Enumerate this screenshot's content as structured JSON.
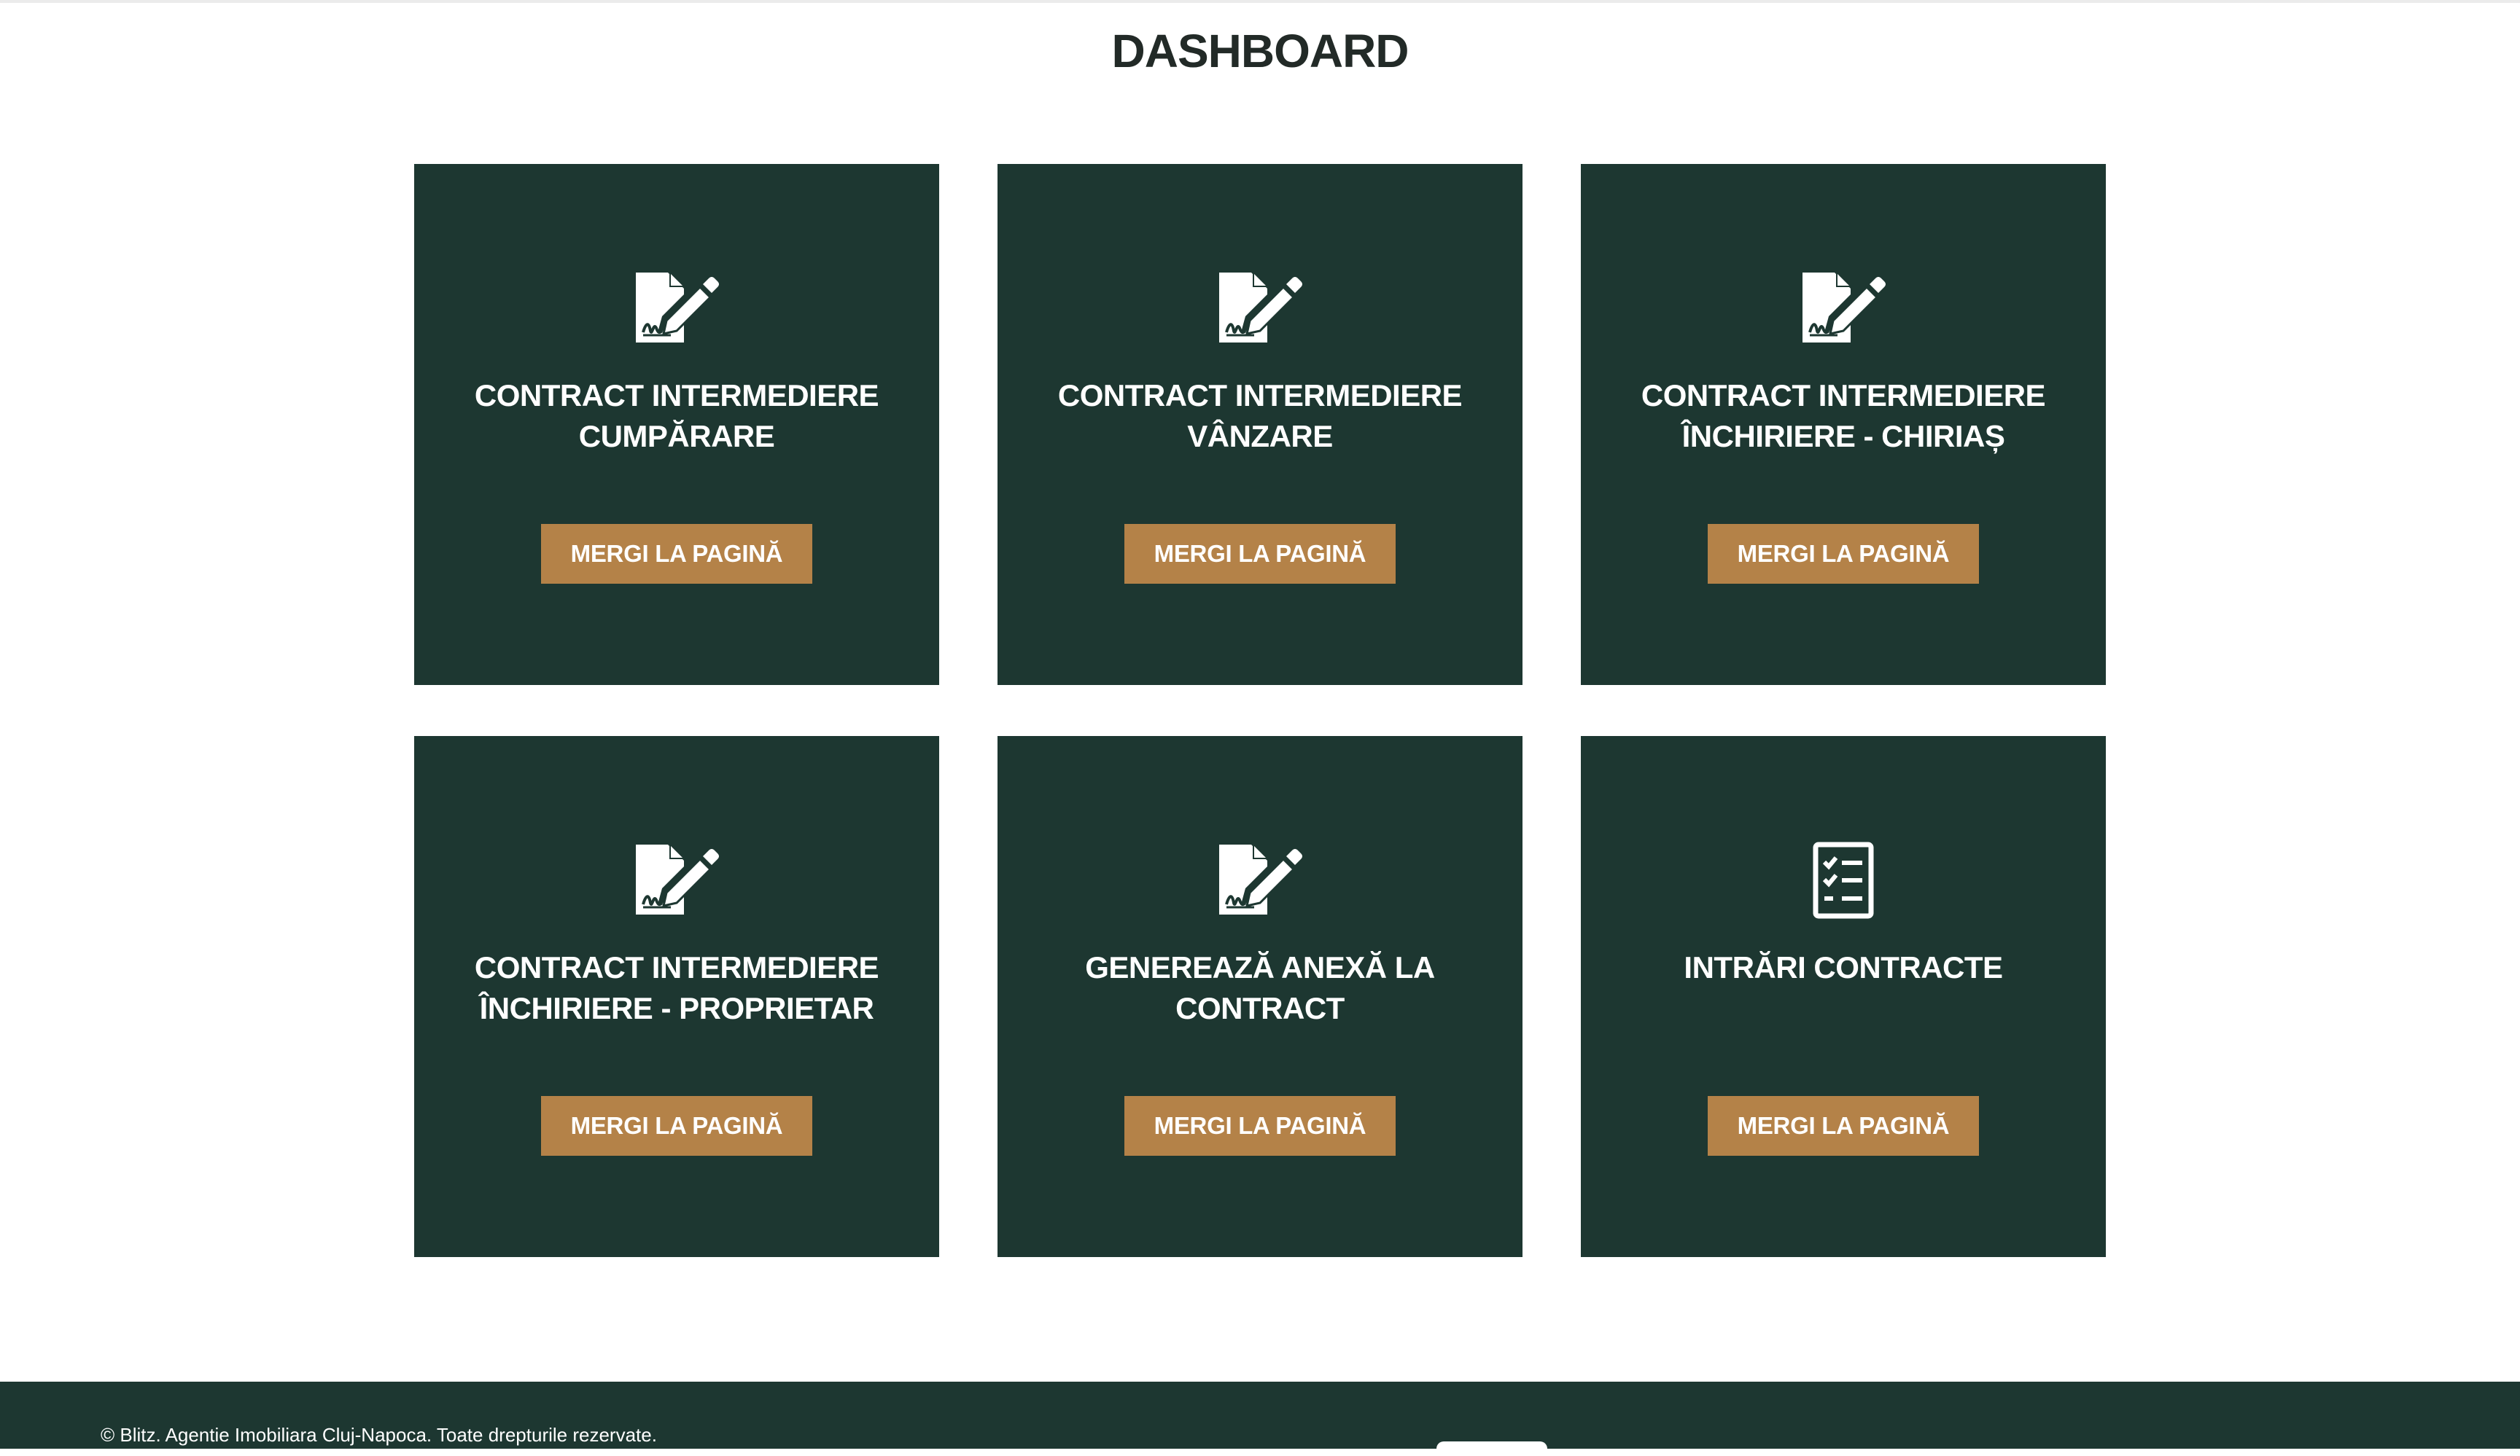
{
  "page": {
    "title": "DASHBOARD"
  },
  "cards": [
    {
      "title": "CONTRACT INTERMEDIERE\nCUMPĂRARE",
      "button": "MERGI LA PAGINĂ",
      "icon": "file-signature-icon"
    },
    {
      "title": "CONTRACT INTERMEDIERE\nVÂNZARE",
      "button": "MERGI LA PAGINĂ",
      "icon": "file-signature-icon"
    },
    {
      "title": "CONTRACT INTERMEDIERE\nÎNCHIRIERE - CHIRIAȘ",
      "button": "MERGI LA PAGINĂ",
      "icon": "file-signature-icon"
    },
    {
      "title": "CONTRACT INTERMEDIERE\nÎNCHIRIERE - PROPRIETAR",
      "button": "MERGI LA PAGINĂ",
      "icon": "file-signature-icon"
    },
    {
      "title": "GENEREAZĂ ANEXĂ LA\nCONTRACT",
      "button": "MERGI LA PAGINĂ",
      "icon": "file-signature-icon"
    },
    {
      "title": "INTRĂRI CONTRACTE",
      "button": "MERGI LA PAGINĂ",
      "icon": "checklist-icon"
    }
  ],
  "footer": {
    "copyright": "© Blitz. Agentie Imobiliara Cluj-Napoca. Toate drepturile rezervate."
  },
  "colors": {
    "card_background": "#1d3731",
    "button_background": "#b48248",
    "title_text": "#222a27"
  }
}
